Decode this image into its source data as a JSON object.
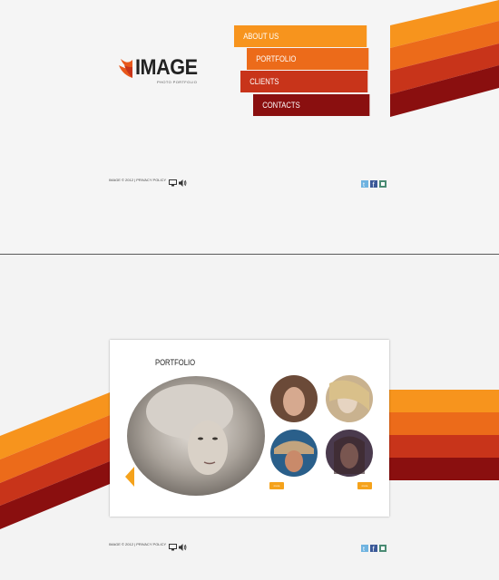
{
  "top": {
    "logo": {
      "title": "IMAGE",
      "subtitle": "PHOTO PORTFOLIO"
    },
    "menu": [
      {
        "label": "ABOUT US"
      },
      {
        "label": "PORTFOLIO"
      },
      {
        "label": "CLIENTS"
      },
      {
        "label": "CONTACTS"
      }
    ],
    "footer": {
      "copyright": "IMAGE © 2012 | PRIVACY POLICY"
    }
  },
  "bottom": {
    "card": {
      "title": "PORTFOLIO",
      "button_left": "more",
      "button_right": "more"
    },
    "footer": {
      "copyright": "IMAGE © 2012 | PRIVACY POLICY"
    }
  },
  "colors": {
    "orange": "#f7941d",
    "orange_dark": "#e8581b",
    "red": "#c8341a",
    "maroon": "#8a0f0f"
  },
  "icons": [
    "monitor-icon",
    "speaker-icon",
    "twitter-icon",
    "facebook-icon",
    "rss-icon",
    "arrow-left-icon"
  ]
}
